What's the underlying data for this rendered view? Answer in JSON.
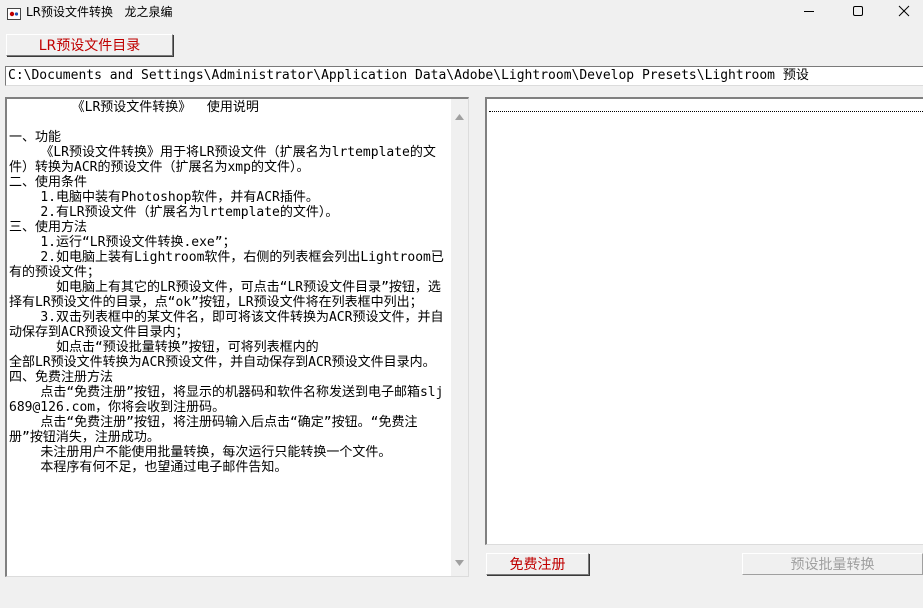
{
  "window": {
    "title": "LR预设文件转换   龙之泉编"
  },
  "toolbar": {
    "dir_button_label": "LR预设文件目录"
  },
  "path": {
    "value": "C:\\Documents and Settings\\Administrator\\Application Data\\Adobe\\Lightroom\\Develop Presets\\Lightroom 预设"
  },
  "instructions": {
    "text": "        《LR预设文件转换》  使用说明\n\n一、功能\n    《LR预设文件转换》用于将LR预设文件（扩展名为lrtemplate的文件）转换为ACR的预设文件（扩展名为xmp的文件）。\n二、使用条件\n    1.电脑中装有Photoshop软件，并有ACR插件。\n    2.有LR预设文件（扩展名为lrtemplate的文件）。\n三、使用方法\n    1.运行“LR预设文件转换.exe”；\n    2.如电脑上装有Lightroom软件，右侧的列表框会列出Lightroom已有的预设文件；\n      如电脑上有其它的LR预设文件，可点击“LR预设文件目录”按钮，选择有LR预设文件的目录，点“ok”按钮，LR预设文件将在列表框中列出；\n    3.双击列表框中的某文件名，即可将该文件转换为ACR预设文件，并自动保存到ACR预设文件目录内；\n      如点击“预设批量转换”按钮，可将列表框内的\n全部LR预设文件转换为ACR预设文件，并自动保存到ACR预设文件目录内。\n四、免费注册方法\n    点击“免费注册”按钮，将显示的机器码和软件名称发送到电子邮箱slj689@126.com，你将会收到注册码。\n    点击“免费注册”按钮，将注册码输入后点击“确定”按钮。“免费注册”按钮消失，注册成功。\n    未注册用户不能使用批量转换，每次运行只能转换一个文件。\n    本程序有何不足，也望通过电子邮件告知。"
  },
  "buttons": {
    "register_label": "免费注册",
    "batch_label": "预设批量转换"
  },
  "colors": {
    "accent_text": "#c00000",
    "disabled_text": "#a0a0a0"
  },
  "icons": {
    "app": "app-icon",
    "minimize": "minimize-icon",
    "maximize": "maximize-icon",
    "close": "close-icon"
  }
}
